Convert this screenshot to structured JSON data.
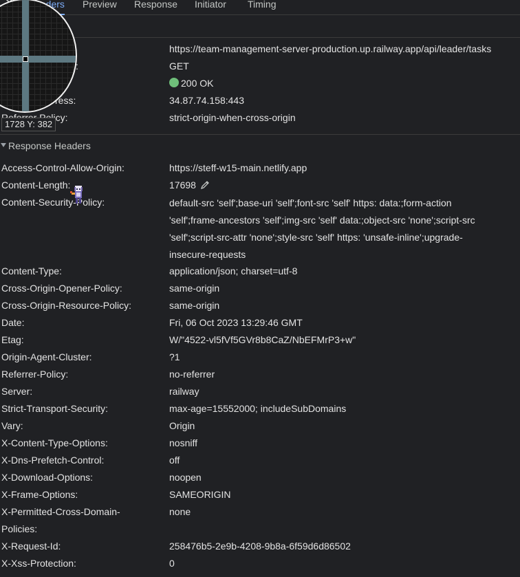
{
  "tabs": [
    {
      "label": "Headers",
      "active": true
    },
    {
      "label": "Preview",
      "active": false
    },
    {
      "label": "Response",
      "active": false
    },
    {
      "label": "Initiator",
      "active": false
    },
    {
      "label": "Timing",
      "active": false
    }
  ],
  "general": {
    "url_value": "https://team-management-server-production.up.railway.app/api/leader/tasks",
    "method_label_partial": ":",
    "method_value": "GET",
    "status_value": "200 OK",
    "remote_label_partial": "ress:",
    "remote_value": "34.87.74.158:443",
    "referrer_label": "Referrer Policy:",
    "referrer_value": "strict-origin-when-cross-origin"
  },
  "magnifier": {
    "coords": "1728 Y: 382"
  },
  "response_headers": {
    "title": "Response Headers",
    "rows": [
      {
        "name": "Access-Control-Allow-Origin:",
        "value": "https://steff-w15-main.netlify.app"
      },
      {
        "name": "Content-Length:",
        "value": "17698"
      },
      {
        "name": "Content-Security-Policy:",
        "lines": [
          "default-src 'self';base-uri 'self';font-src 'self' https: data:;form-action",
          "'self';frame-ancestors 'self';img-src 'self' data:;object-src 'none';script-src",
          "'self';script-src-attr 'none';style-src 'self' https: 'unsafe-inline';upgrade-",
          "insecure-requests"
        ]
      },
      {
        "name": "Content-Type:",
        "value": "application/json; charset=utf-8"
      },
      {
        "name": "Cross-Origin-Opener-Policy:",
        "value": "same-origin"
      },
      {
        "name": "Cross-Origin-Resource-Policy:",
        "value": "same-origin"
      },
      {
        "name": "Date:",
        "value": "Fri, 06 Oct 2023 13:29:46 GMT"
      },
      {
        "name": "Etag:",
        "value": "W/\"4522-vl5fVf5GVr8b8CaZ/NbEFMrP3+w\""
      },
      {
        "name": "Origin-Agent-Cluster:",
        "value": "?1"
      },
      {
        "name": "Referrer-Policy:",
        "value": "no-referrer"
      },
      {
        "name": "Server:",
        "value": "railway"
      },
      {
        "name": "Strict-Transport-Security:",
        "value": "max-age=15552000; includeSubDomains"
      },
      {
        "name": "Vary:",
        "value": "Origin"
      },
      {
        "name": "X-Content-Type-Options:",
        "value": "nosniff"
      },
      {
        "name": "X-Dns-Prefetch-Control:",
        "value": "off"
      },
      {
        "name": "X-Download-Options:",
        "value": "noopen"
      },
      {
        "name": "X-Frame-Options:",
        "value": "SAMEORIGIN"
      },
      {
        "name": "X-Permitted-Cross-Domain-",
        "name2": "Policies:",
        "value": "none"
      },
      {
        "name": "X-Request-Id:",
        "value": "258476b5-2e9b-4208-9b8a-6f59d6d86502"
      },
      {
        "name": "X-Xss-Protection:",
        "value": "0"
      }
    ]
  },
  "colors": {
    "accent": "#7cacf8",
    "status_ok": "#6fbf7a",
    "background": "#202124"
  }
}
